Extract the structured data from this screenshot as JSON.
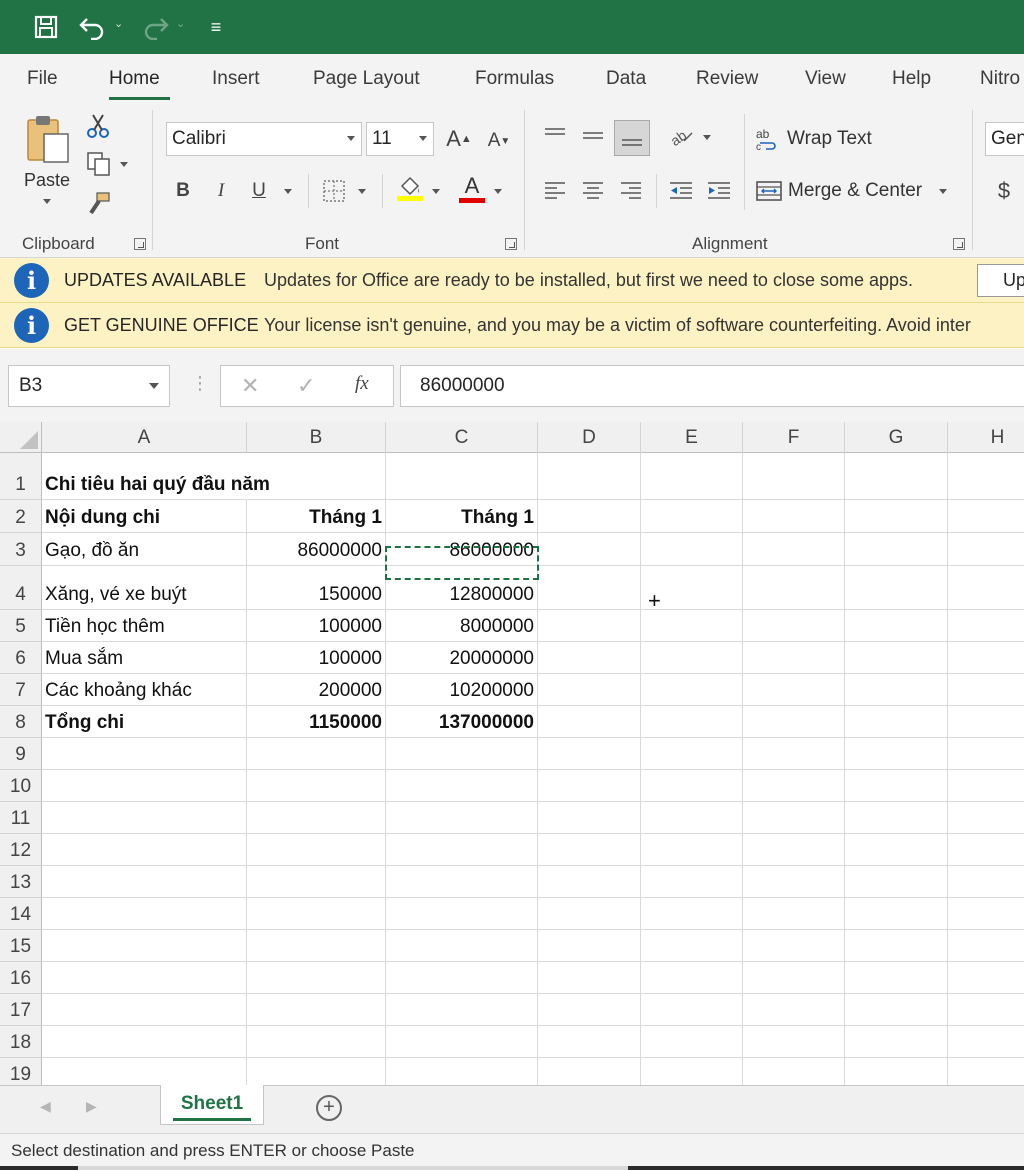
{
  "qat": {
    "customize_label": "≡"
  },
  "tabs": [
    "File",
    "Home",
    "Insert",
    "Page Layout",
    "Formulas",
    "Data",
    "Review",
    "View",
    "Help",
    "Nitro"
  ],
  "ribbon": {
    "clipboard": {
      "paste_label": "Paste",
      "group_label": "Clipboard"
    },
    "font": {
      "font_name": "Calibri",
      "font_size": "11",
      "grow_label": "A",
      "shrink_label": "A",
      "bold_label": "B",
      "italic_label": "I",
      "underline_label": "U",
      "font_color_label": "A",
      "highlight_color": "#ffff00",
      "font_color": "#e00000",
      "group_label": "Font"
    },
    "alignment": {
      "wrap_text_label": "Wrap Text",
      "merge_center_label": "Merge & Center",
      "group_label": "Alignment"
    },
    "number": {
      "format_label": "Gen",
      "currency_label": "$"
    }
  },
  "messages": [
    {
      "title": "UPDATES AVAILABLE",
      "text": "Updates for Office are ready to be installed, but first we need to close some apps.",
      "button": "Up"
    },
    {
      "title": "GET GENUINE OFFICE",
      "text": "Your license isn't genuine, and you may be a victim of software counterfeiting. Avoid inter"
    }
  ],
  "formula_bar": {
    "name_box": "B3",
    "fx_label": "fx",
    "formula": "86000000"
  },
  "grid": {
    "columns": [
      "A",
      "B",
      "C",
      "D",
      "E",
      "F",
      "G",
      "H"
    ],
    "rows": [
      "1",
      "2",
      "3",
      "4",
      "5",
      "6",
      "7",
      "8",
      "9",
      "10",
      "11",
      "12",
      "13",
      "14",
      "15",
      "16",
      "17",
      "18",
      "19"
    ],
    "cells": {
      "A1": "Chi tiêu hai quý đầu năm",
      "A2": "Nội dung chi",
      "B2": "Tháng 1",
      "C2": "Tháng 1",
      "A3": "Gạo, đồ ăn",
      "B3": "86000000",
      "C3": "86000000",
      "A4": "Xăng, vé xe buýt",
      "B4": "150000",
      "C4": "12800000",
      "A5": "Tiền học thêm",
      "B5": "100000",
      "C5": "8000000",
      "A6": "Mua sắm",
      "B6": "100000",
      "C6": "20000000",
      "A7": "Các khoảng khác",
      "B7": "200000",
      "C7": "10200000",
      "A8": "Tổng chi",
      "B8": "1150000",
      "C8": "137000000"
    },
    "cursor_symbol": "+"
  },
  "sheets": {
    "active": "Sheet1",
    "add_label": "+"
  },
  "status": {
    "text": "Select destination and press ENTER or choose Paste"
  },
  "colors": {
    "accent": "#217346",
    "message_bg": "#fcf2c4",
    "info_icon": "#1c65b9"
  }
}
